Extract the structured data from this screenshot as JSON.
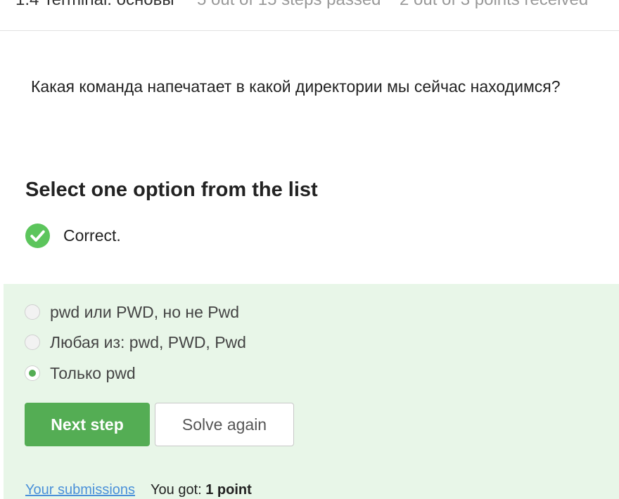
{
  "header": {
    "lesson_title": "1.4 Terminal: основы",
    "steps_passed": "5 out of 15 steps passed",
    "points_received": "2 out of 3 points  received"
  },
  "question": {
    "text": "Какая команда напечатает в какой директории мы сейчас находимся?"
  },
  "quiz": {
    "instruction": "Select one option from the list",
    "result_text": "Correct.",
    "result_icon": "check-circle-icon",
    "accent_color": "#54ad54",
    "panel_color": "#e8f6e8",
    "options": [
      {
        "label": "pwd или PWD, но не Pwd",
        "selected": false
      },
      {
        "label": "Любая из: pwd, PWD, Pwd",
        "selected": false
      },
      {
        "label": "Только pwd",
        "selected": true
      }
    ],
    "next_label": "Next step",
    "solve_again_label": "Solve again"
  },
  "footer": {
    "submissions_label": "Your submissions",
    "you_got_prefix": "You got:",
    "points_value": "1 point"
  }
}
